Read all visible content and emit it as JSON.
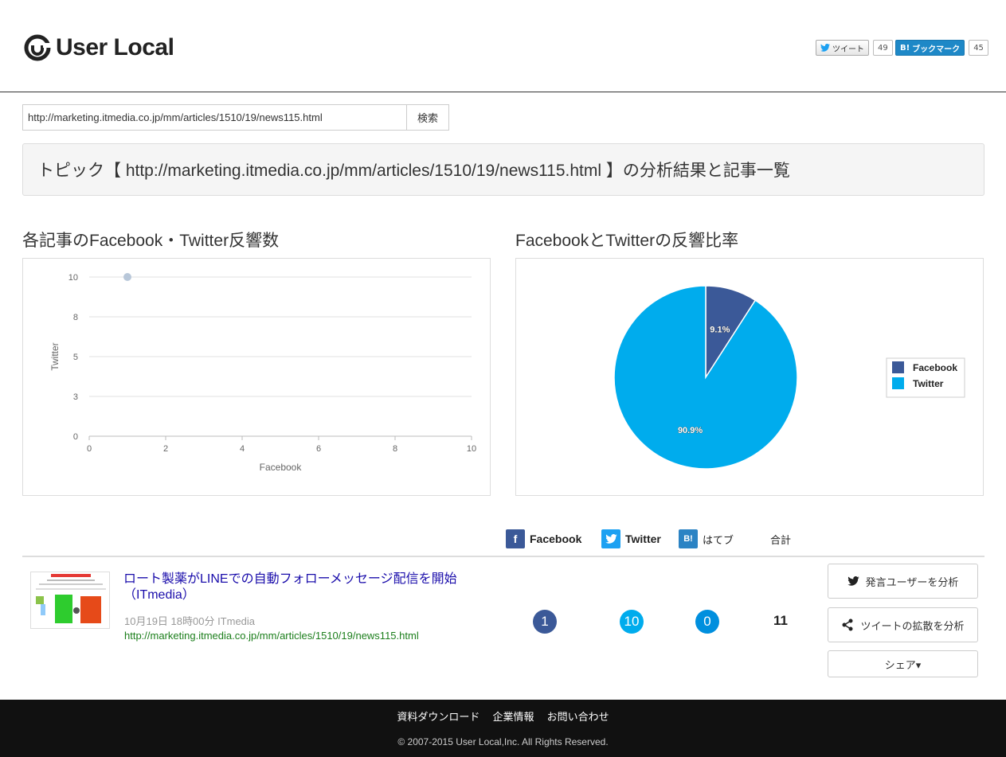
{
  "brand": {
    "name": "User Local"
  },
  "share": {
    "tweet_label": "ツイート",
    "tweet_count": "49",
    "hatena_label": "ブックマーク",
    "hatena_icon_text": "B!",
    "hatena_count": "45"
  },
  "search": {
    "value": "http://marketing.itmedia.co.jp/mm/articles/1510/19/news115.html",
    "button_label": "検索"
  },
  "topic": {
    "heading": "トピック【 http://marketing.itmedia.co.jp/mm/articles/1510/19/news115.html 】の分析結果と記事一覧"
  },
  "sections": {
    "scatter_title": "各記事のFacebook・Twitter反響数",
    "pie_title": "FacebookとTwitterの反響比率"
  },
  "chart_data": [
    {
      "type": "scatter",
      "xlabel": "Facebook",
      "ylabel": "Twitter",
      "xlim": [
        0,
        10
      ],
      "ylim": [
        0,
        10
      ],
      "xticks": [
        "0",
        "2",
        "4",
        "6",
        "8",
        "10"
      ],
      "yticks": [
        "0",
        "3",
        "5",
        "8",
        "10"
      ],
      "grid": true,
      "points": [
        {
          "x": 1,
          "y": 10
        }
      ],
      "colors": {
        "point": "#b8c7d9"
      }
    },
    {
      "type": "pie",
      "slices": [
        {
          "name": "Facebook",
          "value": 9.1,
          "label": "9.1%",
          "color": "#3b5998"
        },
        {
          "name": "Twitter",
          "value": 90.9,
          "label": "90.9%",
          "color": "#00aced"
        }
      ],
      "legend": "right"
    }
  ],
  "list_header": {
    "facebook": "Facebook",
    "twitter": "Twitter",
    "hatena": "はてブ",
    "hatena_icon_text": "B!",
    "total": "合計"
  },
  "article": {
    "title": "ロート製薬がLINEでの自動フォローメッセージ配信を開始（ITmedia）",
    "meta": "10月19日 18時00分  ITmedia",
    "url": "http://marketing.itmedia.co.jp/mm/articles/1510/19/news115.html",
    "facebook": "1",
    "twitter": "10",
    "hatena": "0",
    "total": "11",
    "btn_users": "発言ユーザーを分析",
    "btn_spread": "ツイートの拡散を分析",
    "btn_share": "シェア▾"
  },
  "footer": {
    "links": [
      "資料ダウンロード",
      "企業情報",
      "お問い合わせ"
    ],
    "copyright": "© 2007-2015 User Local,Inc. All Rights Reserved."
  },
  "colors": {
    "facebook": "#3b5998",
    "twitter": "#00aced",
    "hatena": "#008fde"
  }
}
